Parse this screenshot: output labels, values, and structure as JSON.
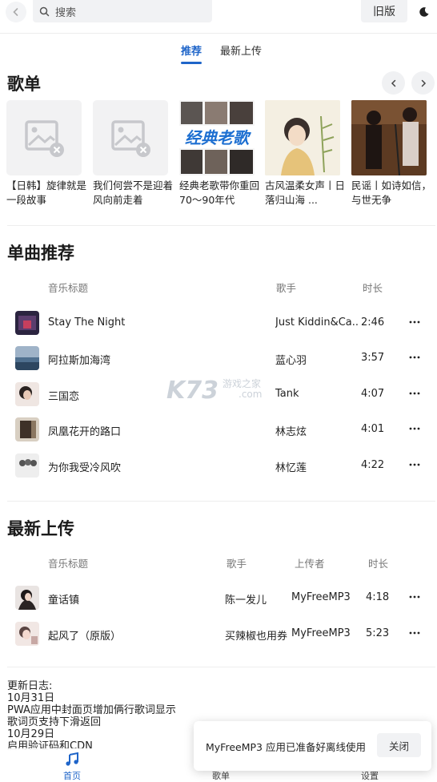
{
  "header": {
    "search_placeholder": "搜索",
    "old_version_label": "旧版",
    "back_icon": "chevron-left-icon",
    "theme_icon": "moon-icon"
  },
  "tabs": [
    {
      "label": "推荐",
      "active": true
    },
    {
      "label": "最新上传",
      "active": false
    }
  ],
  "playlists": {
    "title": "歌单",
    "items": [
      {
        "title": "【日韩】旋律就是一段故事",
        "cover": "broken-image-icon"
      },
      {
        "title": "我们何尝不是迎着风向前走着",
        "cover": "broken-image-icon"
      },
      {
        "title": "经典老歌带你重回70～90年代",
        "cover": "经典老歌"
      },
      {
        "title": "古风温柔女声丨日落归山海 ...",
        "cover": "illustration"
      },
      {
        "title": "民谣丨如诗如信，与世无争",
        "cover": "photo"
      }
    ]
  },
  "songs": {
    "title": "单曲推荐",
    "headers": {
      "title": "音乐标题",
      "artist": "歌手",
      "duration": "时长"
    },
    "rows": [
      {
        "title": "Stay The Night",
        "artist": "Just Kiddin&Ca...",
        "duration": "2:46",
        "thumb_color": "#3a2b4a"
      },
      {
        "title": "阿拉斯加海湾",
        "artist": "蓝心羽",
        "duration": "3:57",
        "thumb_color": "#6d8aa8"
      },
      {
        "title": "三国恋",
        "artist": "Tank",
        "duration": "4:07",
        "thumb_color": "#4a3a36"
      },
      {
        "title": "凤凰花开的路口",
        "artist": "林志炫",
        "duration": "4:01",
        "thumb_color": "#5c4d3e"
      },
      {
        "title": "为你我受冷风吹",
        "artist": "林忆莲",
        "duration": "4:22",
        "thumb_color": "#c9c9c9"
      }
    ]
  },
  "uploads": {
    "title": "最新上传",
    "headers": {
      "title": "音乐标题",
      "artist": "歌手",
      "uploader": "上传者",
      "duration": "时长"
    },
    "rows": [
      {
        "title": "童话镇",
        "artist": "陈一发儿",
        "uploader": "MyFreeMP3",
        "duration": "4:18",
        "thumb_color": "#2e2a2c"
      },
      {
        "title": "起风了（原版）",
        "artist": "买辣椒也用券",
        "uploader": "MyFreeMP3",
        "duration": "5:23",
        "thumb_color": "#d8c3bf"
      }
    ]
  },
  "changelog": {
    "lines": [
      "更新日志:",
      "10月31日",
      "PWA应用中封面页增加俩行歌词显示",
      "歌词页支持下滑返回",
      "10月29日",
      "启用验证码和CDN"
    ]
  },
  "toast": {
    "message": "MyFreeMP3 应用已准备好离线使用",
    "close_label": "关闭"
  },
  "bottom_nav": [
    {
      "label": "首页",
      "icon": "music-note-icon",
      "active": true
    },
    {
      "label": "歌单",
      "icon": "",
      "active": false
    },
    {
      "label": "设置",
      "icon": "",
      "active": false
    }
  ],
  "watermark": {
    "brand": "K73",
    "text": "游戏之家",
    "domain": ".com"
  },
  "colors": {
    "accent": "#1f65c9",
    "divider": "#eeeeee",
    "muted": "#777777"
  }
}
